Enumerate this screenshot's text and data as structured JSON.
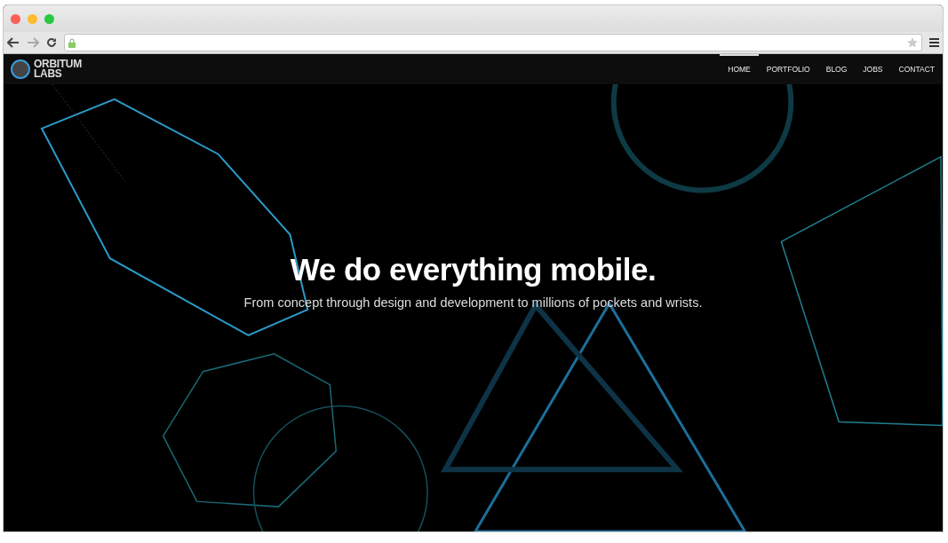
{
  "brand": {
    "line1": "ORBITUM",
    "line2": "LABS"
  },
  "nav": [
    {
      "label": "HOME",
      "selected": true
    },
    {
      "label": "PORTFOLIO",
      "selected": false
    },
    {
      "label": "BLOG",
      "selected": false
    },
    {
      "label": "JOBS",
      "selected": false
    },
    {
      "label": "CONTACT",
      "selected": false
    }
  ],
  "hero": {
    "title": "We do everything mobile.",
    "subtitle": "From concept through design and development to millions of pockets and wrists."
  }
}
